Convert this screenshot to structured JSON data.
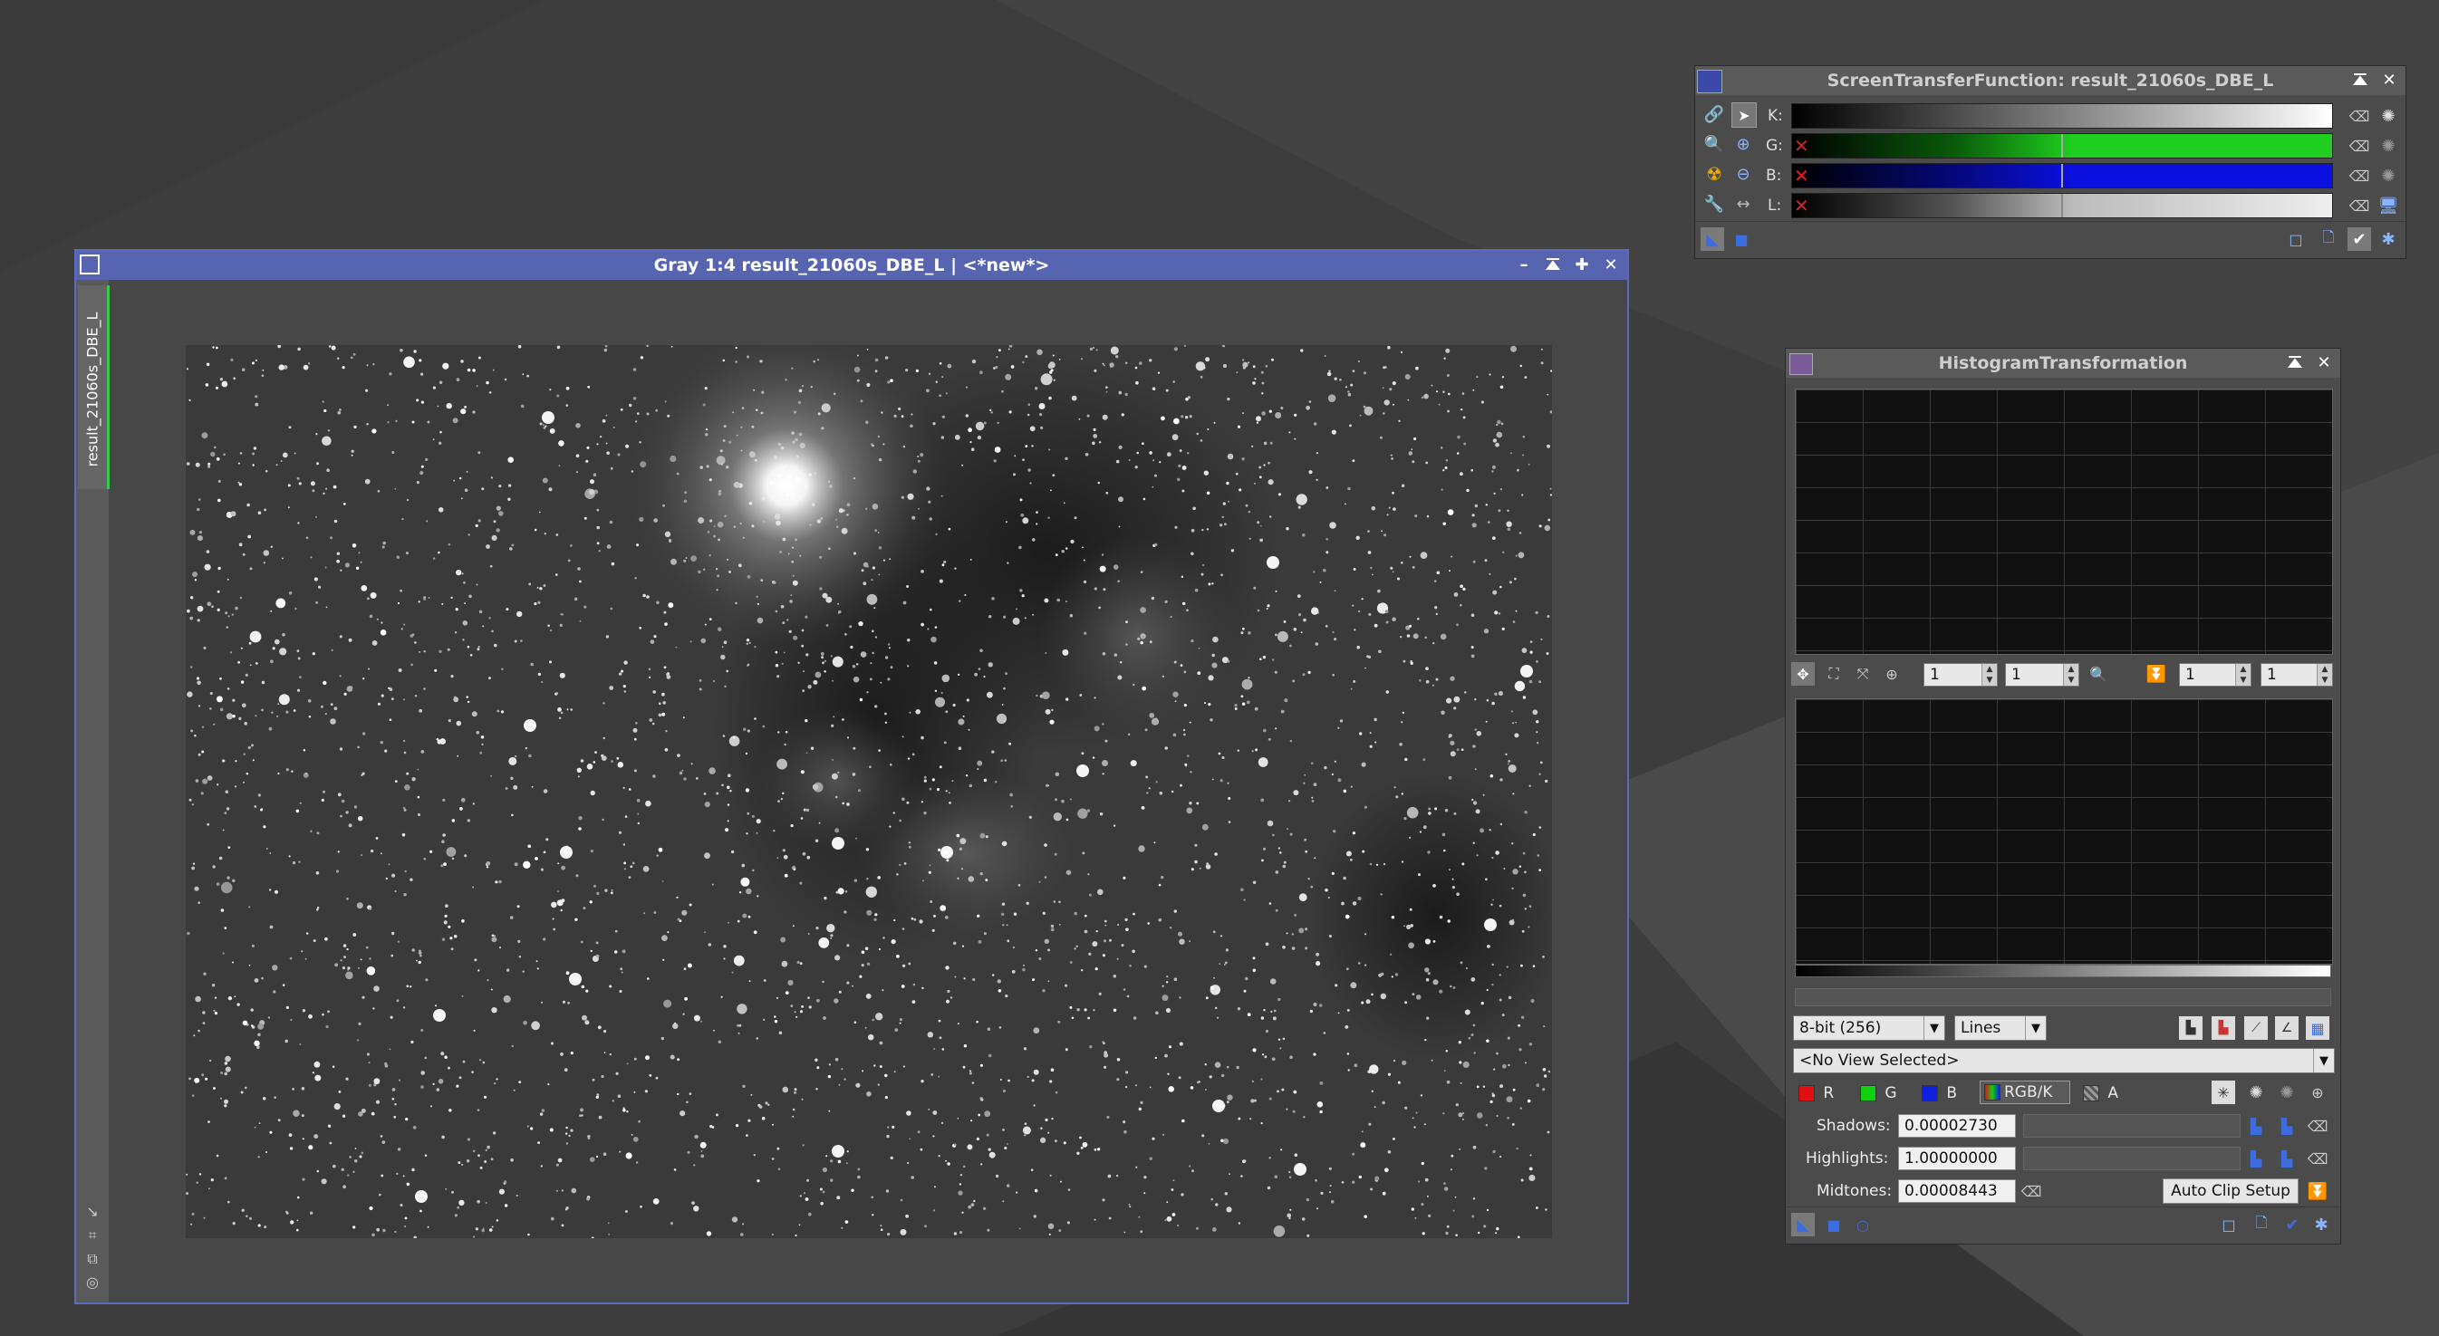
{
  "colors": {
    "accent_blue": "#5764b0",
    "stf_green": "#1fcf1f",
    "stf_blue": "#0a10e0",
    "image_border": "#5c6bc0"
  },
  "image_window": {
    "title": "Gray 1:4 result_21060s_DBE_L | <*new*>",
    "side_tab": "result_21060s_DBE_L",
    "buttons": [
      "minimize",
      "shade",
      "maximize",
      "close"
    ]
  },
  "stf": {
    "title": "ScreenTransferFunction: result_21060s_DBE_L",
    "channels": [
      {
        "label": "K:",
        "key": "k"
      },
      {
        "label": "G:",
        "key": "g"
      },
      {
        "label": "B:",
        "key": "b"
      },
      {
        "label": "L:",
        "key": "l"
      }
    ]
  },
  "ht": {
    "title": "HistogramTransformation",
    "zoom": {
      "h1": "1",
      "v1": "1",
      "h2": "1",
      "v2": "1"
    },
    "resolution": "8-bit (256)",
    "graph_style": "Lines",
    "view": "<No View Selected>",
    "channels": {
      "r": "R",
      "g": "G",
      "b": "B",
      "rgbk": "RGB/K",
      "a": "A"
    },
    "shadows_label": "Shadows:",
    "shadows": "0.00002730",
    "highlights_label": "Highlights:",
    "highlights": "1.00000000",
    "midtones_label": "Midtones:",
    "midtones": "0.00008443",
    "auto_clip": "Auto Clip Setup"
  }
}
